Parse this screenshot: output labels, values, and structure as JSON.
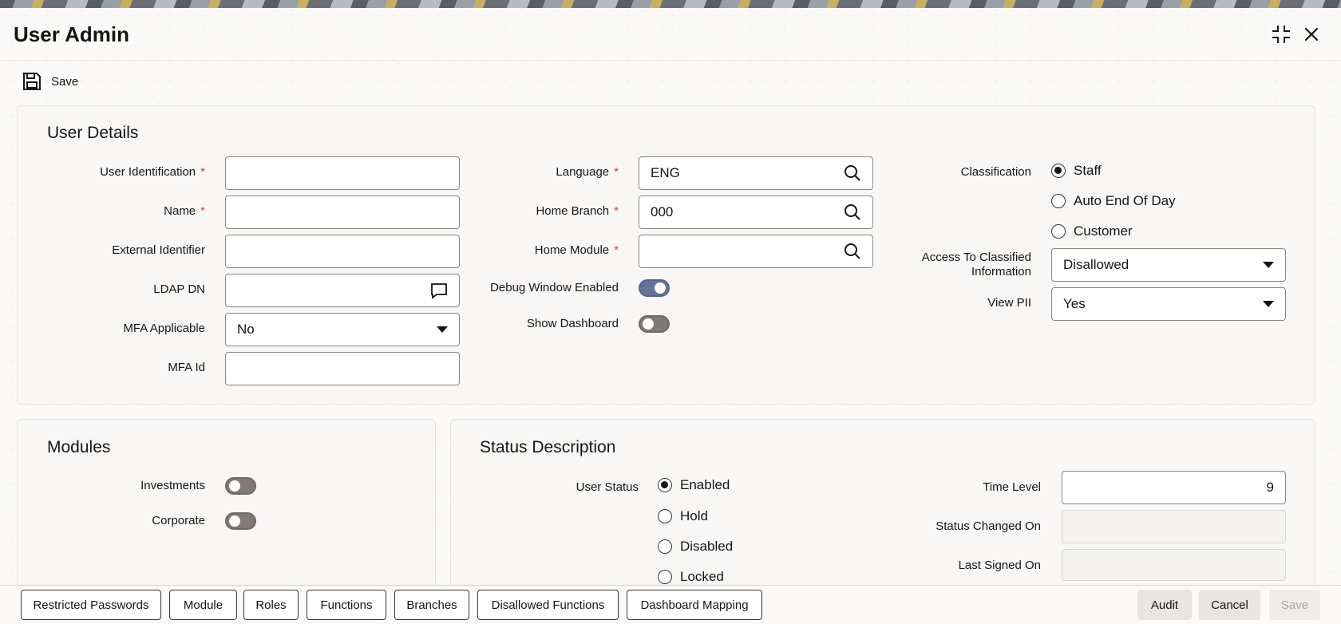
{
  "header": {
    "title": "User Admin",
    "maximize_icon": "collapse-corners-icon",
    "close_icon": "close-icon"
  },
  "toolbar": {
    "save_label": "Save",
    "save_icon": "floppy-disk-icon"
  },
  "user_details": {
    "title": "User Details",
    "user_identification": {
      "label": "User Identification",
      "required": "*",
      "value": ""
    },
    "name": {
      "label": "Name",
      "required": "*",
      "value": ""
    },
    "external_identifier": {
      "label": "External Identifier",
      "value": ""
    },
    "ldap_dn": {
      "label": "LDAP DN",
      "value": "",
      "icon": "comment-icon"
    },
    "mfa_applicable": {
      "label": "MFA Applicable",
      "value": "No"
    },
    "mfa_id": {
      "label": "MFA Id",
      "value": ""
    },
    "language": {
      "label": "Language",
      "required": "*",
      "value": "ENG"
    },
    "home_branch": {
      "label": "Home Branch",
      "required": "*",
      "value": "000"
    },
    "home_module": {
      "label": "Home Module",
      "required": "*",
      "value": ""
    },
    "debug_window": {
      "label": "Debug Window Enabled",
      "state": "on"
    },
    "show_dashboard": {
      "label": "Show Dashboard",
      "state": "off"
    },
    "classification": {
      "label": "Classification",
      "options": [
        "Staff",
        "Auto End Of Day",
        "Customer"
      ],
      "selected": "Staff"
    },
    "access_classified": {
      "label_line1": "Access To Classified",
      "label_line2": "Information",
      "value": "Disallowed"
    },
    "view_pii": {
      "label": "View PII",
      "value": "Yes"
    }
  },
  "modules": {
    "title": "Modules",
    "investments": {
      "label": "Investments",
      "state": "off"
    },
    "corporate": {
      "label": "Corporate",
      "state": "off"
    }
  },
  "status": {
    "title": "Status Description",
    "user_status": {
      "label": "User Status",
      "options": [
        "Enabled",
        "Hold",
        "Disabled",
        "Locked"
      ],
      "selected": "Enabled"
    },
    "time_level": {
      "label": "Time Level",
      "value": "9"
    },
    "status_changed_on": {
      "label": "Status Changed On",
      "value": ""
    },
    "last_signed_on": {
      "label": "Last Signed On",
      "value": ""
    }
  },
  "footer": {
    "tabs": [
      "Restricted Passwords",
      "Module",
      "Roles",
      "Functions",
      "Branches",
      "Disallowed Functions",
      "Dashboard Mapping"
    ],
    "audit_label": "Audit",
    "cancel_label": "Cancel",
    "save_label": "Save"
  },
  "colors": {
    "required": "#c74634",
    "toggle_on": "#66749a",
    "toggle_off": "#807a72",
    "panel_bg": "#f8f7f5"
  }
}
